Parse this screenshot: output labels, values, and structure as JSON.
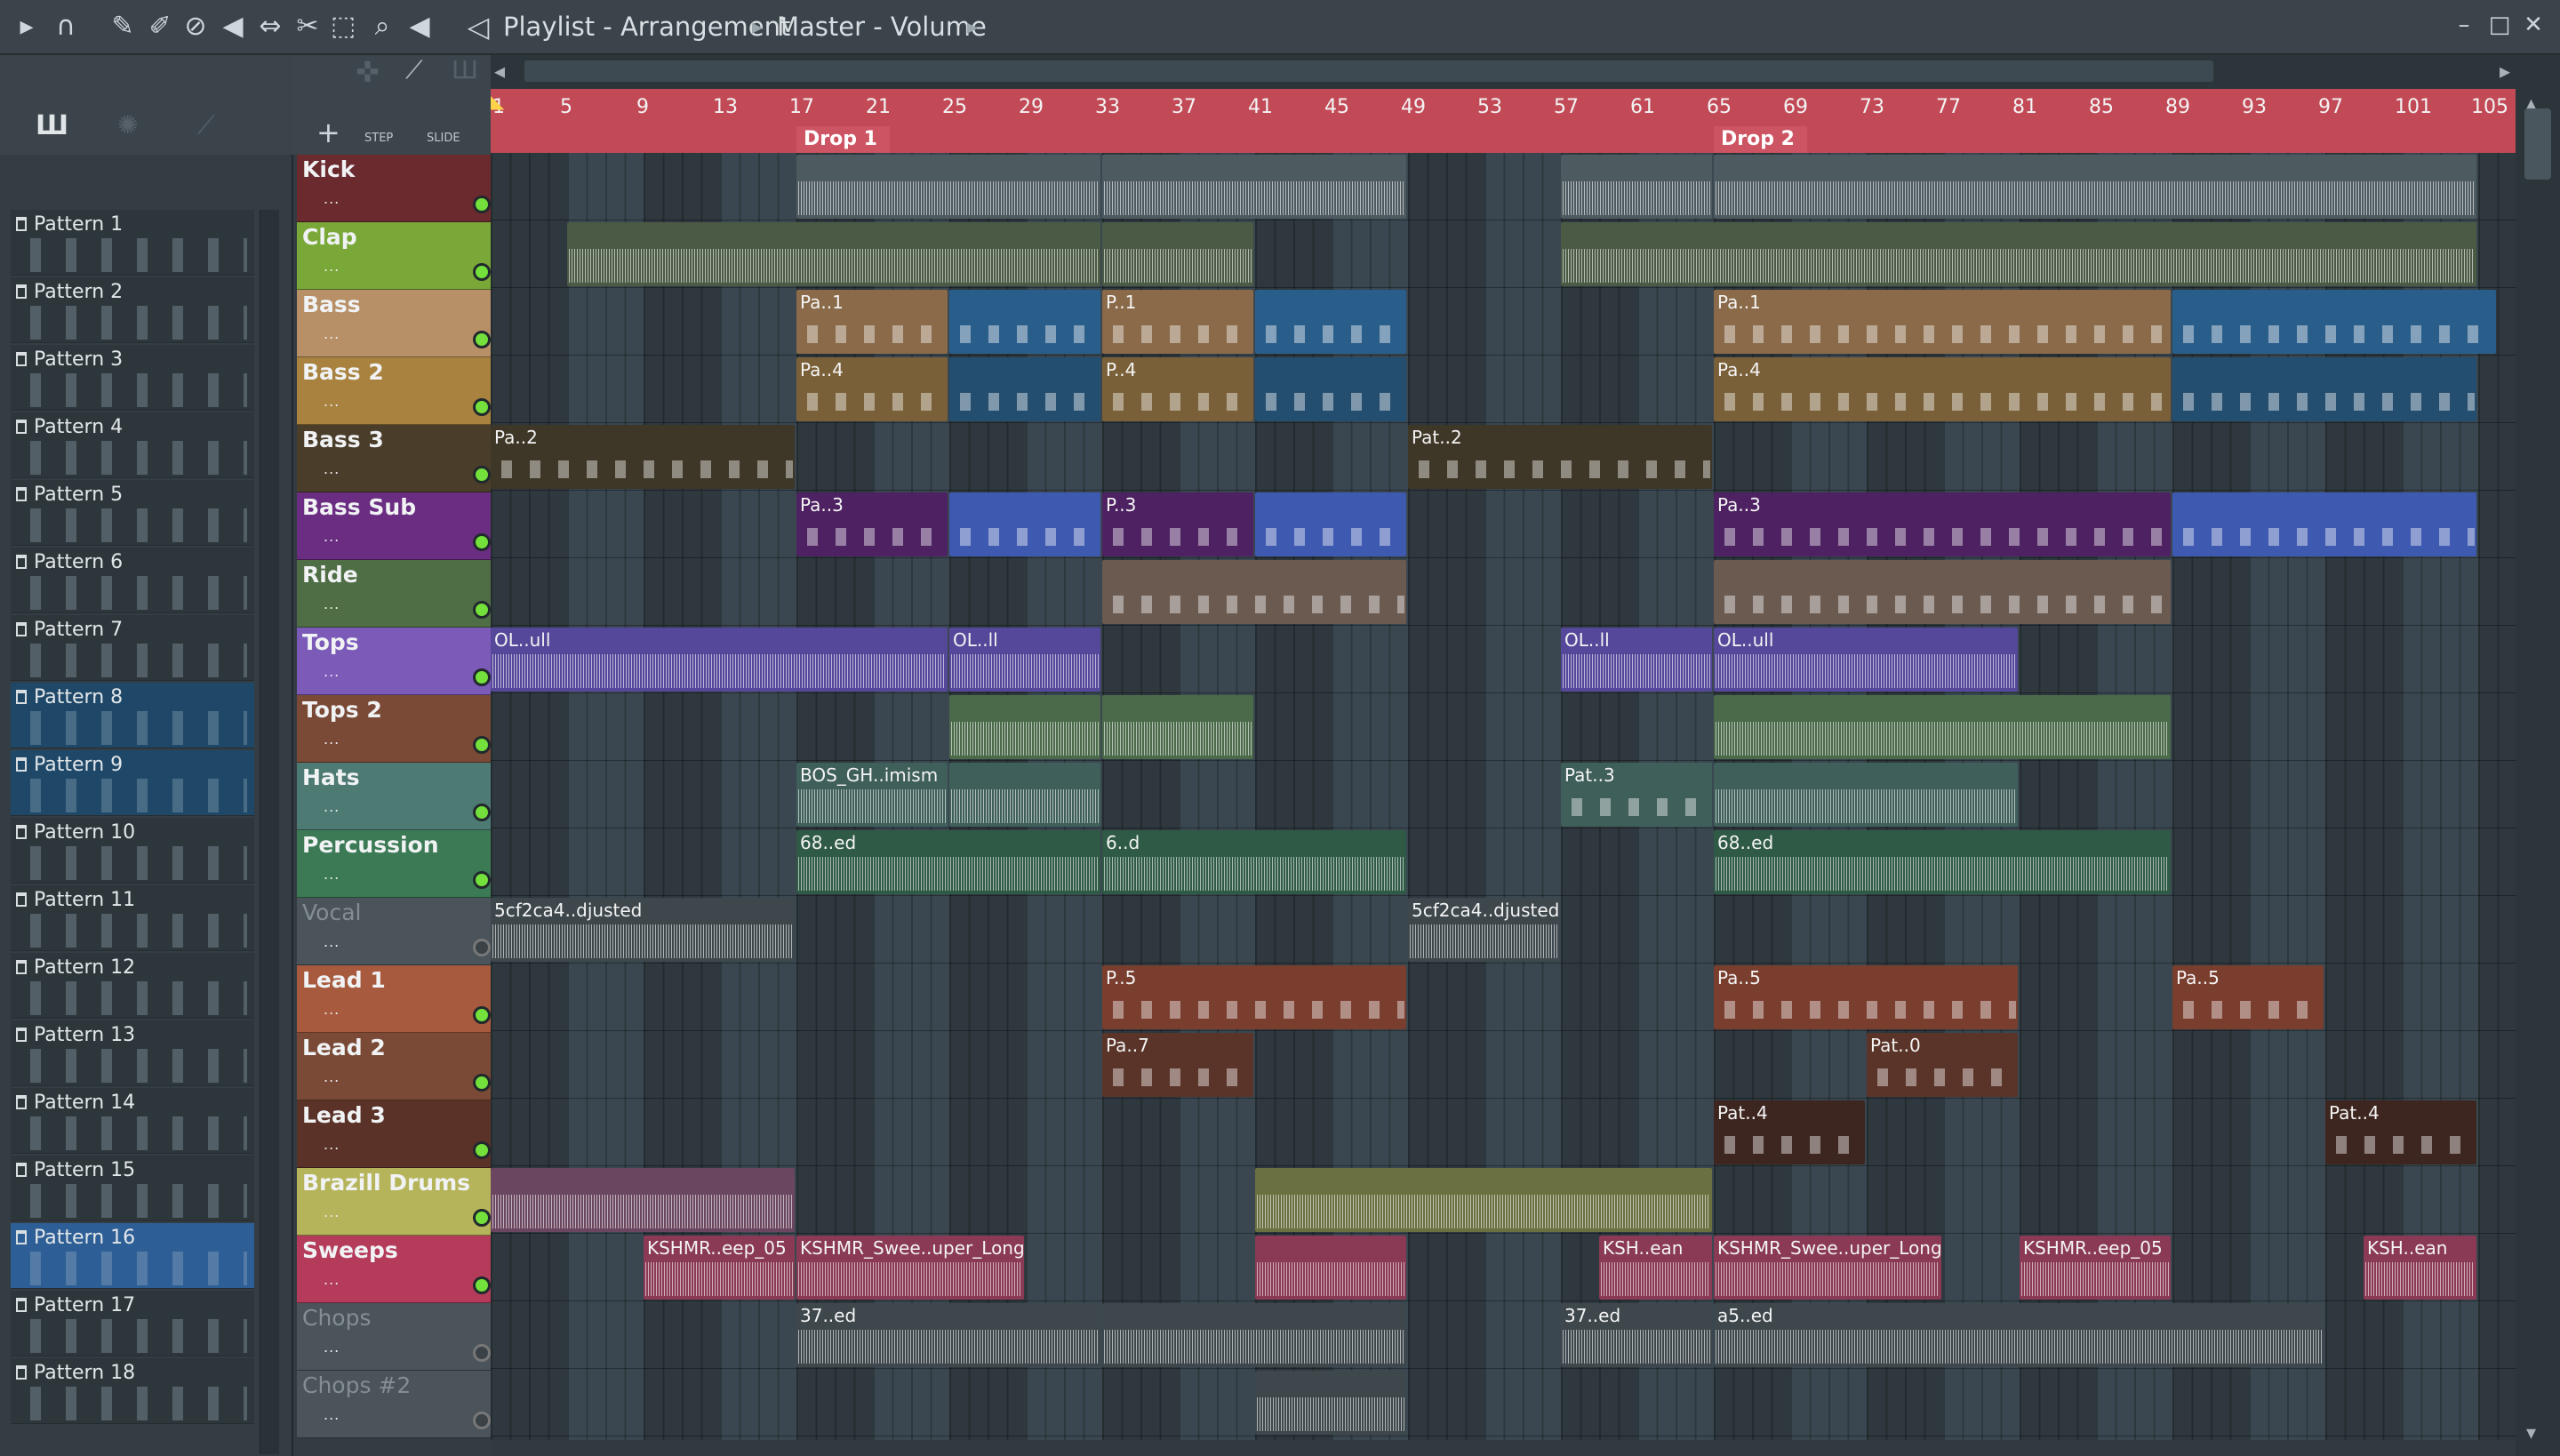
{
  "window": {
    "title_icon": "speaker-icon",
    "breadcrumb": [
      "Playlist - Arrangement",
      "Master - Volume"
    ]
  },
  "toolbar": {
    "icons": [
      "play-arrow-icon",
      "magnet-icon",
      "pencil-icon",
      "brush-icon",
      "delete-icon",
      "mute-icon",
      "slip-icon",
      "slice-icon",
      "select-icon",
      "zoom-icon",
      "playback-icon"
    ]
  },
  "left_panel": {
    "step_label": "STEP",
    "slide_label": "SLIDE",
    "patterns": [
      "Pattern 1",
      "Pattern 2",
      "Pattern 3",
      "Pattern 4",
      "Pattern 5",
      "Pattern 6",
      "Pattern 7",
      "Pattern 8",
      "Pattern 9",
      "Pattern 10",
      "Pattern 11",
      "Pattern 12",
      "Pattern 13",
      "Pattern 14",
      "Pattern 15",
      "Pattern 16",
      "Pattern 17",
      "Pattern 18"
    ],
    "add_label": "+"
  },
  "timeline": {
    "bars": [
      "1",
      "5",
      "9",
      "13",
      "17",
      "21",
      "25",
      "29",
      "33",
      "37",
      "41",
      "45",
      "49",
      "53",
      "57",
      "61",
      "65",
      "69",
      "73",
      "77",
      "81",
      "85",
      "89",
      "93",
      "97",
      "101",
      "105"
    ],
    "markers": [
      "Drop 1",
      "Drop 2"
    ]
  },
  "tracks": [
    {
      "name": "Kick",
      "color": "#6a2a2e",
      "enabled": true
    },
    {
      "name": "Clap",
      "color": "#7aa838",
      "enabled": true
    },
    {
      "name": "Bass",
      "color": "#b89068",
      "enabled": true
    },
    {
      "name": "Bass 2",
      "color": "#a8823e",
      "enabled": true
    },
    {
      "name": "Bass 3",
      "color": "#4a3d2a",
      "enabled": true
    },
    {
      "name": "Bass Sub",
      "color": "#6b2d82",
      "enabled": true
    },
    {
      "name": "Ride",
      "color": "#4f6e45",
      "enabled": true
    },
    {
      "name": "Tops",
      "color": "#7b5ab8",
      "enabled": true
    },
    {
      "name": "Tops 2",
      "color": "#7a4a36",
      "enabled": true
    },
    {
      "name": "Hats",
      "color": "#4e7a74",
      "enabled": true
    },
    {
      "name": "Percussion",
      "color": "#3c7a55",
      "enabled": true
    },
    {
      "name": "Vocal",
      "color": "#4a545a",
      "enabled": false
    },
    {
      "name": "Lead 1",
      "color": "#a85a3e",
      "enabled": true
    },
    {
      "name": "Lead 2",
      "color": "#7a4a36",
      "enabled": true
    },
    {
      "name": "Lead 3",
      "color": "#5a3228",
      "enabled": true
    },
    {
      "name": "Brazill Drums",
      "color": "#b6b45a",
      "enabled": true
    },
    {
      "name": "Sweeps",
      "color": "#b43c5a",
      "enabled": true
    },
    {
      "name": "Chops",
      "color": "#4a545a",
      "enabled": false
    },
    {
      "name": "Chops #2",
      "color": "#4a545a",
      "enabled": false
    }
  ],
  "clips": [
    {
      "lane": 0,
      "bar": 17,
      "len": 16,
      "label": "",
      "color": "#4d5a60",
      "kind": "audio"
    },
    {
      "lane": 0,
      "bar": 33,
      "len": 16,
      "label": "",
      "color": "#4d5a60",
      "kind": "audio"
    },
    {
      "lane": 0,
      "bar": 57,
      "len": 8,
      "label": "",
      "color": "#4d5a60",
      "kind": "audio"
    },
    {
      "lane": 0,
      "bar": 65,
      "len": 40,
      "label": "",
      "color": "#4d5a60",
      "kind": "audio"
    },
    {
      "lane": 1,
      "bar": 5,
      "len": 28,
      "label": "",
      "color": "#4a5a44",
      "kind": "audio"
    },
    {
      "lane": 1,
      "bar": 33,
      "len": 8,
      "label": "",
      "color": "#4a5a44",
      "kind": "audio"
    },
    {
      "lane": 1,
      "bar": 57,
      "len": 48,
      "label": "",
      "color": "#4a5a44",
      "kind": "audio"
    },
    {
      "lane": 2,
      "bar": 17,
      "len": 8,
      "label": "Pa..1",
      "color": "#8a6a48",
      "kind": "notes"
    },
    {
      "lane": 2,
      "bar": 25,
      "len": 8,
      "label": "",
      "color": "#2a5e8a",
      "kind": "notes"
    },
    {
      "lane": 2,
      "bar": 33,
      "len": 8,
      "label": "P..1",
      "color": "#8a6a48",
      "kind": "notes"
    },
    {
      "lane": 2,
      "bar": 41,
      "len": 8,
      "label": "",
      "color": "#2a5e8a",
      "kind": "notes"
    },
    {
      "lane": 2,
      "bar": 65,
      "len": 24,
      "label": "Pa..1",
      "color": "#8a6a48",
      "kind": "notes"
    },
    {
      "lane": 2,
      "bar": 89,
      "len": 17,
      "label": "",
      "color": "#2a5e8a",
      "kind": "notes"
    },
    {
      "lane": 3,
      "bar": 17,
      "len": 8,
      "label": "Pa..4",
      "color": "#7a6038",
      "kind": "notes"
    },
    {
      "lane": 3,
      "bar": 25,
      "len": 8,
      "label": "",
      "color": "#244e70",
      "kind": "notes"
    },
    {
      "lane": 3,
      "bar": 33,
      "len": 8,
      "label": "P..4",
      "color": "#7a6038",
      "kind": "notes"
    },
    {
      "lane": 3,
      "bar": 41,
      "len": 8,
      "label": "",
      "color": "#244e70",
      "kind": "notes"
    },
    {
      "lane": 3,
      "bar": 65,
      "len": 24,
      "label": "Pa..4",
      "color": "#7a6038",
      "kind": "notes"
    },
    {
      "lane": 3,
      "bar": 89,
      "len": 16,
      "label": "",
      "color": "#244e70",
      "kind": "notes"
    },
    {
      "lane": 4,
      "bar": 1,
      "len": 16,
      "label": "Pa..2",
      "color": "#3e3626",
      "kind": "notes"
    },
    {
      "lane": 4,
      "bar": 49,
      "len": 16,
      "label": "Pat..2",
      "color": "#3e3626",
      "kind": "notes"
    },
    {
      "lane": 5,
      "bar": 17,
      "len": 8,
      "label": "Pa..3",
      "color": "#4e2262",
      "kind": "notes"
    },
    {
      "lane": 5,
      "bar": 25,
      "len": 8,
      "label": "",
      "color": "#3e5ab0",
      "kind": "notes"
    },
    {
      "lane": 5,
      "bar": 33,
      "len": 8,
      "label": "P..3",
      "color": "#4e2262",
      "kind": "notes"
    },
    {
      "lane": 5,
      "bar": 41,
      "len": 8,
      "label": "",
      "color": "#3e5ab0",
      "kind": "notes"
    },
    {
      "lane": 5,
      "bar": 65,
      "len": 24,
      "label": "Pa..3",
      "color": "#4e2262",
      "kind": "notes"
    },
    {
      "lane": 5,
      "bar": 89,
      "len": 16,
      "label": "",
      "color": "#3e5ab0",
      "kind": "notes"
    },
    {
      "lane": 6,
      "bar": 33,
      "len": 16,
      "label": "",
      "color": "#6a5a50",
      "kind": "notes"
    },
    {
      "lane": 6,
      "bar": 65,
      "len": 24,
      "label": "",
      "color": "#6a5a50",
      "kind": "notes"
    },
    {
      "lane": 7,
      "bar": 1,
      "len": 24,
      "label": "OL..ull",
      "color": "#55489a",
      "kind": "audio"
    },
    {
      "lane": 7,
      "bar": 25,
      "len": 8,
      "label": "OL..ll",
      "color": "#55489a",
      "kind": "audio"
    },
    {
      "lane": 7,
      "bar": 57,
      "len": 8,
      "label": "OL..ll",
      "color": "#55489a",
      "kind": "audio"
    },
    {
      "lane": 7,
      "bar": 65,
      "len": 16,
      "label": "OL..ull",
      "color": "#55489a",
      "kind": "audio"
    },
    {
      "lane": 8,
      "bar": 25,
      "len": 8,
      "label": "",
      "color": "#4b6a4a",
      "kind": "audio"
    },
    {
      "lane": 8,
      "bar": 33,
      "len": 8,
      "label": "",
      "color": "#4b6a4a",
      "kind": "audio"
    },
    {
      "lane": 8,
      "bar": 65,
      "len": 24,
      "label": "",
      "color": "#4b6a4a",
      "kind": "audio"
    },
    {
      "lane": 9,
      "bar": 17,
      "len": 8,
      "label": "BOS_GH..imism",
      "color": "#3f5f5a",
      "kind": "audio"
    },
    {
      "lane": 9,
      "bar": 25,
      "len": 8,
      "label": "",
      "color": "#3f5f5a",
      "kind": "audio"
    },
    {
      "lane": 9,
      "bar": 57,
      "len": 8,
      "label": "Pat..3",
      "color": "#3f5f5a",
      "kind": "notes"
    },
    {
      "lane": 9,
      "bar": 65,
      "len": 16,
      "label": "",
      "color": "#3f5f5a",
      "kind": "audio"
    },
    {
      "lane": 10,
      "bar": 17,
      "len": 16,
      "label": "68..ed",
      "color": "#2f5a46",
      "kind": "audio"
    },
    {
      "lane": 10,
      "bar": 33,
      "len": 16,
      "label": "6..d",
      "color": "#2f5a46",
      "kind": "audio"
    },
    {
      "lane": 10,
      "bar": 65,
      "len": 24,
      "label": "68..ed",
      "color": "#2f5a46",
      "kind": "audio"
    },
    {
      "lane": 11,
      "bar": 1,
      "len": 16,
      "label": "5cf2ca4..djusted",
      "color": "#3d474c",
      "kind": "audio"
    },
    {
      "lane": 11,
      "bar": 49,
      "len": 8,
      "label": "5cf2ca4..djusted",
      "color": "#3d474c",
      "kind": "audio"
    },
    {
      "lane": 12,
      "bar": 33,
      "len": 16,
      "label": "P..5",
      "color": "#7a3e2e",
      "kind": "notes"
    },
    {
      "lane": 12,
      "bar": 65,
      "len": 16,
      "label": "Pa..5",
      "color": "#7a3e2e",
      "kind": "notes"
    },
    {
      "lane": 12,
      "bar": 89,
      "len": 8,
      "label": "Pa..5",
      "color": "#7a3e2e",
      "kind": "notes"
    },
    {
      "lane": 13,
      "bar": 33,
      "len": 8,
      "label": "Pa..7",
      "color": "#5a3428",
      "kind": "notes"
    },
    {
      "lane": 13,
      "bar": 73,
      "len": 8,
      "label": "Pat..0",
      "color": "#5a3428",
      "kind": "notes"
    },
    {
      "lane": 14,
      "bar": 65,
      "len": 8,
      "label": "Pat..4",
      "color": "#3e2620",
      "kind": "notes"
    },
    {
      "lane": 14,
      "bar": 97,
      "len": 8,
      "label": "Pat..4",
      "color": "#3e2620",
      "kind": "notes"
    },
    {
      "lane": 15,
      "bar": 1,
      "len": 16,
      "label": "",
      "color": "#6a4660",
      "kind": "audio"
    },
    {
      "lane": 15,
      "bar": 41,
      "len": 24,
      "label": "",
      "color": "#6a7040",
      "kind": "audio"
    },
    {
      "lane": 16,
      "bar": 9,
      "len": 8,
      "label": "KSHMR..eep_05",
      "color": "#8a3a54",
      "kind": "audio"
    },
    {
      "lane": 16,
      "bar": 17,
      "len": 12,
      "label": "KSHMR_Swee..uper_Long",
      "color": "#8a3a54",
      "kind": "audio"
    },
    {
      "lane": 16,
      "bar": 41,
      "len": 8,
      "label": "",
      "color": "#8a3a54",
      "kind": "audio"
    },
    {
      "lane": 16,
      "bar": 59,
      "len": 6,
      "label": "KSH..ean",
      "color": "#8a3a54",
      "kind": "audio"
    },
    {
      "lane": 16,
      "bar": 65,
      "len": 12,
      "label": "KSHMR_Swee..uper_Long",
      "color": "#8a3a54",
      "kind": "audio"
    },
    {
      "lane": 16,
      "bar": 81,
      "len": 8,
      "label": "KSHMR..eep_05",
      "color": "#8a3a54",
      "kind": "audio"
    },
    {
      "lane": 16,
      "bar": 99,
      "len": 6,
      "label": "KSH..ean",
      "color": "#8a3a54",
      "kind": "audio"
    },
    {
      "lane": 17,
      "bar": 17,
      "len": 16,
      "label": "37..ed",
      "color": "#3d474c",
      "kind": "audio"
    },
    {
      "lane": 17,
      "bar": 33,
      "len": 16,
      "label": "",
      "color": "#3d474c",
      "kind": "audio"
    },
    {
      "lane": 17,
      "bar": 57,
      "len": 8,
      "label": "37..ed",
      "color": "#3d474c",
      "kind": "audio"
    },
    {
      "lane": 17,
      "bar": 65,
      "len": 32,
      "label": "a5..ed",
      "color": "#3d474c",
      "kind": "audio"
    },
    {
      "lane": 18,
      "bar": 41,
      "len": 8,
      "label": "",
      "color": "#3d474c",
      "kind": "audio"
    }
  ]
}
